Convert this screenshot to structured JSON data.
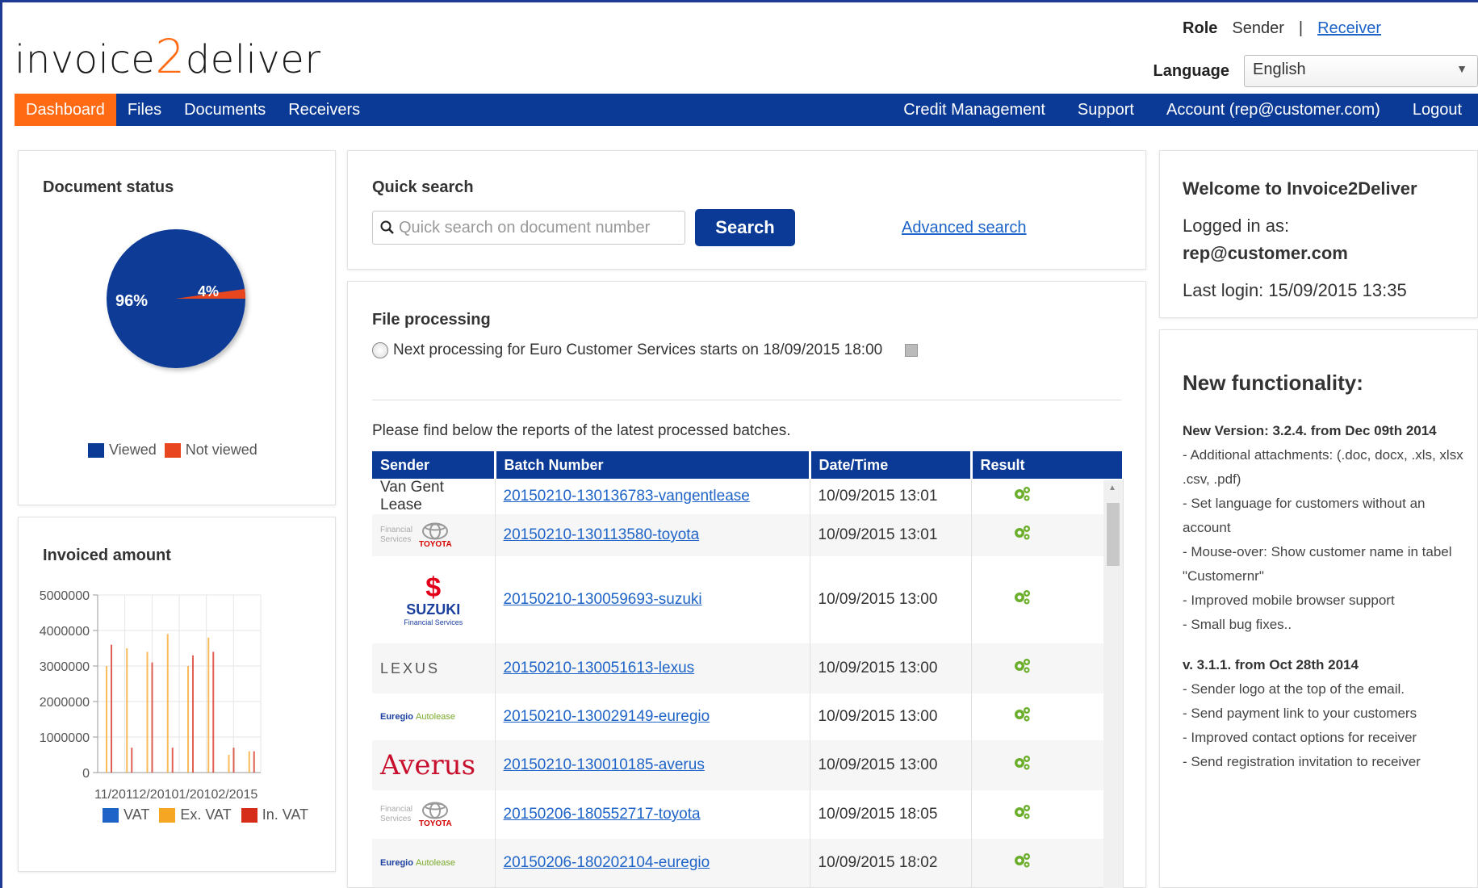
{
  "header": {
    "logo_prefix": "invoice",
    "logo_two": "2",
    "logo_suffix": "deliver",
    "role_label": "Role",
    "role_sender": "Sender",
    "role_separator": "|",
    "role_receiver": "Receiver",
    "language_label": "Language",
    "language_value": "English"
  },
  "nav": {
    "left": [
      "Dashboard",
      "Files",
      "Documents",
      "Receivers"
    ],
    "right": [
      "Credit Management",
      "Support",
      "Account (rep@customer.com)",
      "Logout"
    ]
  },
  "doc_status": {
    "title": "Document status",
    "viewed_pct_label": "96%",
    "not_viewed_pct_label": "4%",
    "legend_viewed": "Viewed",
    "legend_not_viewed": "Not viewed",
    "colors": {
      "viewed": "#0a3a96",
      "not_viewed": "#e8461e"
    }
  },
  "invoiced": {
    "title": "Invoiced amount",
    "legend": [
      "VAT",
      "Ex. VAT",
      "In. VAT"
    ],
    "colors": {
      "vat": "#1e64c8",
      "ex_vat": "#f5a623",
      "in_vat": "#d62c1a"
    }
  },
  "chart_data": {
    "type": "bar",
    "title": "Invoiced amount",
    "y_ticks": [
      "5000000",
      "4000000",
      "3000000",
      "2000000",
      "1000000",
      "0"
    ],
    "x_tick_label": "11/20112/20101/20102/2015",
    "ylim": [
      0,
      5000000
    ],
    "series": [
      {
        "name": "Ex. VAT",
        "values": [
          3000000,
          3500000,
          3400000,
          3900000,
          3000000,
          3800000,
          500000,
          600000
        ]
      },
      {
        "name": "In. VAT",
        "values": [
          3600000,
          700000,
          3100000,
          700000,
          3300000,
          3400000,
          700000,
          600000
        ]
      }
    ]
  },
  "quick_search": {
    "title": "Quick search",
    "placeholder": "Quick search on document number",
    "button": "Search",
    "advanced": "Advanced search"
  },
  "file_processing": {
    "title": "File processing",
    "next": "Next processing for Euro Customer Services starts on 18/09/2015 18:00",
    "reports_text": "Please find below the reports of the latest processed batches.",
    "columns": [
      "Sender",
      "Batch Number",
      "Date/Time",
      "Result"
    ],
    "rows": [
      {
        "sender": "Van Gent Lease",
        "batch": "20150210-130136783-vangentlease",
        "datetime": "10/09/2015 13:01"
      },
      {
        "sender_logo": "toyota",
        "sender_text_a": "Financial",
        "sender_text_b": "Services",
        "sender_word": "TOYOTA",
        "batch": "20150210-130113580-toyota",
        "datetime": "10/09/2015 13:01"
      },
      {
        "sender_logo": "suzuki",
        "sender_word": "SUZUKI",
        "sender_sub": "Financial Services",
        "batch": "20150210-130059693-suzuki",
        "datetime": "10/09/2015 13:00"
      },
      {
        "sender_logo": "lexus",
        "sender_word": "LEXUS",
        "batch": "20150210-130051613-lexus",
        "datetime": "10/09/2015 13:00"
      },
      {
        "sender_logo": "euregio",
        "sender_word": "Euregio",
        "sender_sub": "Autolease",
        "batch": "20150210-130029149-euregio",
        "datetime": "10/09/2015 13:00"
      },
      {
        "sender_logo": "averus",
        "sender_word": "Averus",
        "batch": "20150210-130010185-averus",
        "datetime": "10/09/2015 13:00"
      },
      {
        "sender_logo": "toyota",
        "sender_text_a": "Financial",
        "sender_text_b": "Services",
        "sender_word": "TOYOTA",
        "batch": "20150206-180552717-toyota",
        "datetime": "10/09/2015 18:05"
      },
      {
        "sender_logo": "euregio",
        "sender_word": "Euregio",
        "sender_sub": "Autolease",
        "batch": "20150206-180202104-euregio",
        "datetime": "10/09/2015 18:02"
      }
    ]
  },
  "welcome": {
    "title": "Welcome to Invoice2Deliver",
    "logged_in_label": "Logged in as:",
    "user": "rep@customer.com",
    "last_login": "Last login: 15/09/2015 13:35"
  },
  "new_functionality": {
    "title": "New functionality:",
    "v1_title": "New Version: 3.2.4. from Dec 09th 2014",
    "v1_items": [
      "- Additional attachments: (.doc, docx, .xls, xlsx .csv, .pdf)",
      "- Set language for customers without an account",
      "- Mouse-over: Show customer name in tabel \"Customernr\"",
      "- Improved mobile browser support",
      "- Small bug fixes.."
    ],
    "v2_title": "v. 3.1.1. from Oct 28th 2014",
    "v2_items": [
      "- Sender logo at the top of the email.",
      "- Send payment link to your customers",
      "- Improved contact options for receiver",
      "- Send registration invitation to receiver"
    ]
  }
}
